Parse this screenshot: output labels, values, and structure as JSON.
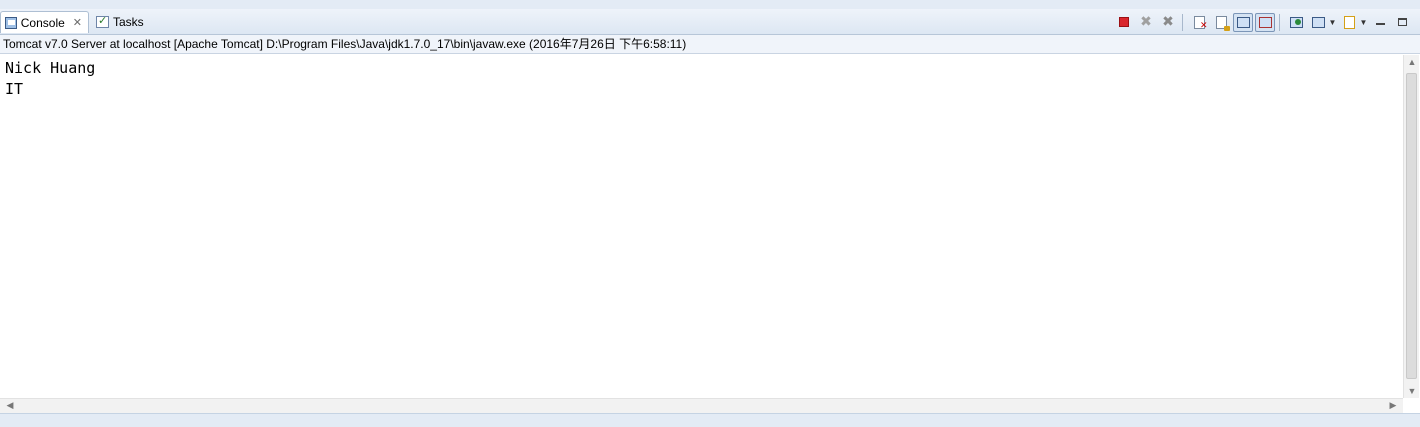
{
  "tabs": [
    {
      "label": "Console",
      "icon": "console-icon",
      "active": true,
      "closable": true
    },
    {
      "label": "Tasks",
      "icon": "tasks-icon",
      "active": false
    }
  ],
  "close_glyph": "✕",
  "toolbar_icons": [
    "terminate-icon",
    "remove-launch-icon",
    "remove-all-terminated-icon",
    "clear-console-icon",
    "scroll-lock-icon",
    "show-on-stdout-icon",
    "show-on-stderr-icon",
    "pin-console-icon",
    "display-selected-console-icon",
    "open-console-icon",
    "minimize-icon",
    "maximize-icon"
  ],
  "description": "Tomcat v7.0 Server at localhost [Apache Tomcat] D:\\Program Files\\Java\\jdk1.7.0_17\\bin\\javaw.exe (2016年7月26日 下午6:58:11)",
  "console_lines": [
    "Nick Huang",
    "IT"
  ],
  "colors": {
    "stop": "#d9262d",
    "tab_bar": "#dde7f3",
    "frame": "#e3ebf5"
  }
}
